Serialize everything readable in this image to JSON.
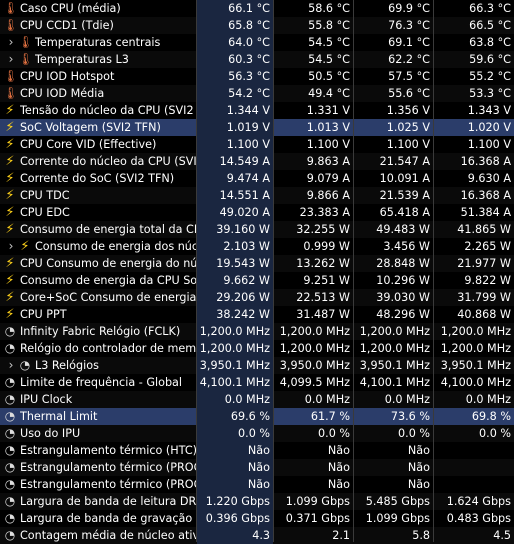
{
  "rows": [
    {
      "icon": "thermometer-icon",
      "indent": 0,
      "label": "Caso CPU (média)",
      "v": [
        "66.1 °C",
        "58.6 °C",
        "69.9 °C",
        "66.3 °C"
      ]
    },
    {
      "icon": "thermometer-icon",
      "indent": 0,
      "label": "CPU CCD1 (Tdie)",
      "v": [
        "65.8 °C",
        "55.8 °C",
        "76.3 °C",
        "66.5 °C"
      ]
    },
    {
      "icon": "chevron-thermometer-icon",
      "indent": 1,
      "label": "Temperaturas centrais",
      "v": [
        "64.0 °C",
        "54.5 °C",
        "69.1 °C",
        "63.8 °C"
      ]
    },
    {
      "icon": "chevron-thermometer-icon",
      "indent": 1,
      "label": "Temperaturas L3",
      "v": [
        "60.3 °C",
        "54.5 °C",
        "62.2 °C",
        "59.6 °C"
      ]
    },
    {
      "icon": "thermometer-icon",
      "indent": 0,
      "label": "CPU IOD Hotspot",
      "v": [
        "56.3 °C",
        "50.5 °C",
        "57.5 °C",
        "55.2 °C"
      ]
    },
    {
      "icon": "thermometer-icon",
      "indent": 0,
      "label": "CPU IOD Média",
      "v": [
        "54.2 °C",
        "49.4 °C",
        "55.6 °C",
        "53.3 °C"
      ]
    },
    {
      "icon": "bolt-icon",
      "indent": 0,
      "label": "Tensão do núcleo da CPU (SVI2 ...",
      "v": [
        "1.344 V",
        "1.331 V",
        "1.356 V",
        "1.343 V"
      ]
    },
    {
      "icon": "bolt-icon",
      "indent": 0,
      "label": "SoC Voltagem (SVI2 TFN)",
      "v": [
        "1.019 V",
        "1.013 V",
        "1.025 V",
        "1.020 V"
      ],
      "hl": true
    },
    {
      "icon": "bolt-icon",
      "indent": 0,
      "label": "CPU Core VID (Effective)",
      "v": [
        "1.100 V",
        "1.100 V",
        "1.100 V",
        "1.100 V"
      ]
    },
    {
      "icon": "bolt-icon",
      "indent": 0,
      "label": "Corrente do núcleo da CPU (SVI2...",
      "v": [
        "14.549 A",
        "9.863 A",
        "21.547 A",
        "16.368 A"
      ]
    },
    {
      "icon": "bolt-icon",
      "indent": 0,
      "label": "Corrente do SoC (SVI2 TFN)",
      "v": [
        "9.474 A",
        "9.079 A",
        "10.091 A",
        "9.630 A"
      ]
    },
    {
      "icon": "bolt-icon",
      "indent": 0,
      "label": "CPU TDC",
      "v": [
        "14.551 A",
        "9.866 A",
        "21.539 A",
        "16.368 A"
      ]
    },
    {
      "icon": "bolt-icon",
      "indent": 0,
      "label": "CPU EDC",
      "v": [
        "49.020 A",
        "23.383 A",
        "65.418 A",
        "51.384 A"
      ]
    },
    {
      "icon": "bolt-icon",
      "indent": 0,
      "label": "Consumo de energia total da CPU",
      "v": [
        "39.160 W",
        "32.255 W",
        "49.483 W",
        "41.865 W"
      ]
    },
    {
      "icon": "chevron-bolt-icon",
      "indent": 1,
      "label": "Consumo de energia dos núcl...",
      "v": [
        "2.103 W",
        "0.999 W",
        "3.456 W",
        "2.265 W"
      ]
    },
    {
      "icon": "bolt-icon",
      "indent": 0,
      "label": "CPU Consumo de energia do núcl...",
      "v": [
        "19.543 W",
        "13.262 W",
        "28.848 W",
        "21.977 W"
      ]
    },
    {
      "icon": "bolt-icon",
      "indent": 0,
      "label": "Consumo de energia da CPU SoC...",
      "v": [
        "9.662 W",
        "9.251 W",
        "10.296 W",
        "9.822 W"
      ]
    },
    {
      "icon": "bolt-icon",
      "indent": 0,
      "label": "Core+SoC Consumo de energia (...",
      "v": [
        "29.206 W",
        "22.513 W",
        "39.030 W",
        "31.799 W"
      ]
    },
    {
      "icon": "bolt-icon",
      "indent": 0,
      "label": "CPU PPT",
      "v": [
        "38.242 W",
        "31.487 W",
        "48.296 W",
        "40.868 W"
      ]
    },
    {
      "icon": "clock-icon",
      "indent": 0,
      "label": "Infinity Fabric Relógio (FCLK)",
      "v": [
        "1,200.0 MHz",
        "1,200.0 MHz",
        "1,200.0 MHz",
        "1,200.0 MHz"
      ]
    },
    {
      "icon": "clock-icon",
      "indent": 0,
      "label": "Relógio do controlador de memór...",
      "v": [
        "1,200.0 MHz",
        "1,200.0 MHz",
        "1,200.0 MHz",
        "1,200.0 MHz"
      ]
    },
    {
      "icon": "chevron-clock-icon",
      "indent": 1,
      "label": "L3 Relógios",
      "v": [
        "3,950.1 MHz",
        "3,950.0 MHz",
        "3,950.1 MHz",
        "3,950.1 MHz"
      ]
    },
    {
      "icon": "clock-icon",
      "indent": 0,
      "label": "Limite de frequência - Global",
      "v": [
        "4,100.1 MHz",
        "4,099.5 MHz",
        "4,100.1 MHz",
        "4,100.0 MHz"
      ]
    },
    {
      "icon": "clock-icon",
      "indent": 0,
      "label": "IPU Clock",
      "v": [
        "0.0 MHz",
        "0.0 MHz",
        "0.0 MHz",
        "0.0 MHz"
      ]
    },
    {
      "icon": "clock-icon",
      "indent": 0,
      "label": "Thermal Limit",
      "v": [
        "69.6 %",
        "61.7 %",
        "73.6 %",
        "69.8 %"
      ],
      "hl": true
    },
    {
      "icon": "clock-icon",
      "indent": 0,
      "label": "Uso do IPU",
      "v": [
        "0.0 %",
        "0.0 %",
        "0.0 %",
        "0.0 %"
      ]
    },
    {
      "icon": "clock-icon",
      "indent": 0,
      "label": "Estrangulamento térmico (HTC)",
      "v": [
        "Não",
        "Não",
        "Não",
        ""
      ]
    },
    {
      "icon": "clock-icon",
      "indent": 0,
      "label": "Estrangulamento térmico (PROC...",
      "v": [
        "Não",
        "Não",
        "Não",
        ""
      ]
    },
    {
      "icon": "clock-icon",
      "indent": 0,
      "label": "Estrangulamento térmico (PROC...",
      "v": [
        "Não",
        "Não",
        "Não",
        ""
      ]
    },
    {
      "icon": "clock-icon",
      "indent": 0,
      "label": "Largura de banda de leitura DRAM",
      "v": [
        "1.220 Gbps",
        "1.099 Gbps",
        "5.485 Gbps",
        "1.624 Gbps"
      ]
    },
    {
      "icon": "clock-icon",
      "indent": 0,
      "label": "Largura de banda de gravação D...",
      "v": [
        "0.396 Gbps",
        "0.371 Gbps",
        "1.099 Gbps",
        "0.483 Gbps"
      ]
    },
    {
      "icon": "clock-icon",
      "indent": 0,
      "label": "Contagem média de núcleo ativo",
      "v": [
        "4.3",
        "2.1",
        "5.8",
        "4.5"
      ]
    }
  ]
}
